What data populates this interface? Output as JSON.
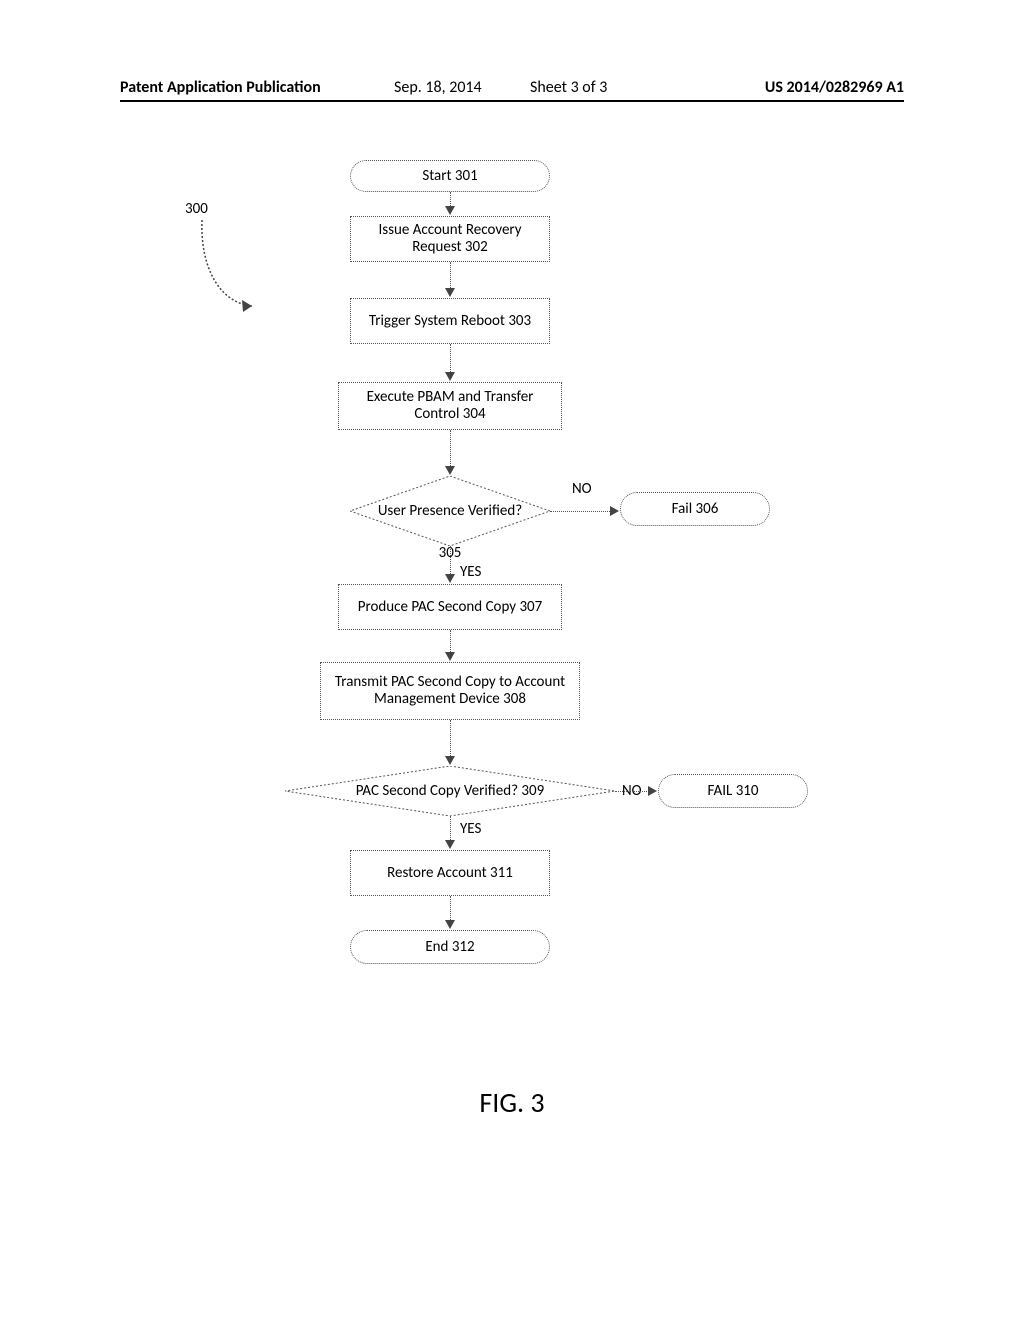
{
  "header": {
    "publication_label": "Patent Application Publication",
    "date": "Sep. 18, 2014",
    "sheet": "Sheet 3 of 3",
    "pub_number": "US 2014/0282969 A1"
  },
  "ref_label": "300",
  "figure_label": "FIG. 3",
  "nodes": {
    "start": "Start 301",
    "issue": "Issue Account Recovery Request 302",
    "trigger": "Trigger System Reboot 303",
    "execute": "Execute PBAM and Transfer Control 304",
    "verify_user": "User Presence Verified?",
    "verify_user_num": "305",
    "fail306": "Fail 306",
    "produce": "Produce PAC Second Copy 307",
    "transmit": "Transmit PAC Second Copy to Account Management Device 308",
    "verify_pac": "PAC Second Copy Verified? 309",
    "fail310": "FAIL 310",
    "restore": "Restore Account 311",
    "end": "End 312"
  },
  "branches": {
    "yes": "YES",
    "no": "NO"
  }
}
